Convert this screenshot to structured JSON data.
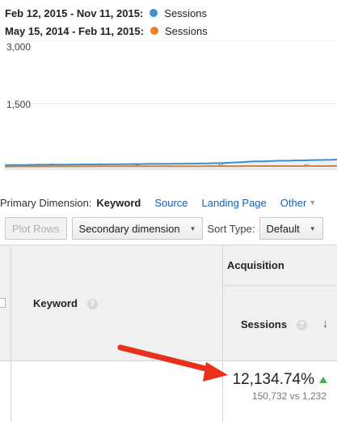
{
  "legend": [
    {
      "range": "Feb 12, 2015 - Nov 11, 2015:",
      "series": "Sessions",
      "color": "#3d8fcf"
    },
    {
      "range": "May 15, 2014 - Feb 11, 2015:",
      "series": "Sessions",
      "color": "#e8822d"
    }
  ],
  "chart": {
    "y_ticks": [
      "3,000",
      "1,500"
    ],
    "x_ticks": [
      "..",
      "..",
      "..",
      ".."
    ]
  },
  "chart_data": {
    "type": "line",
    "ylim": [
      0,
      3000
    ],
    "yticks": [
      3000,
      1500
    ],
    "series": [
      {
        "name": "Sessions",
        "color": "#3d8fcf",
        "values": [
          40,
          42,
          45,
          44,
          46,
          48,
          50,
          49,
          52,
          50,
          51,
          53,
          55,
          54,
          56,
          58,
          57,
          60,
          58,
          61,
          63,
          62,
          64,
          66,
          65,
          68,
          70,
          69,
          72,
          71,
          74,
          73,
          76,
          78,
          77,
          80,
          82,
          84,
          86,
          90,
          96,
          104,
          110,
          118,
          125,
          130,
          128,
          134,
          140,
          145,
          142,
          148,
          152,
          150,
          155,
          158,
          160,
          162,
          165,
          170
        ]
      },
      {
        "name": "Sessions",
        "color": "#e8822d",
        "values": [
          8,
          8,
          9,
          9,
          9,
          10,
          10,
          10,
          10,
          11,
          11,
          11,
          12,
          12,
          12,
          12,
          13,
          13,
          13,
          13,
          14,
          14,
          14,
          14,
          14,
          15,
          15,
          15,
          15,
          15,
          16,
          16,
          16,
          16,
          16,
          16,
          17,
          17,
          17,
          17,
          17,
          17,
          17,
          18,
          18,
          18,
          18,
          18,
          18,
          18,
          18,
          19,
          19,
          19,
          19,
          19,
          19,
          19,
          20,
          20
        ]
      }
    ]
  },
  "dimension_bar": {
    "label": "Primary Dimension:",
    "active": "Keyword",
    "links": [
      "Source",
      "Landing Page"
    ],
    "other": "Other"
  },
  "toolbar": {
    "plot_rows": "Plot Rows",
    "secondary_dimension": "Secondary dimension",
    "sort_type_label": "Sort Type:",
    "sort_type_value": "Default"
  },
  "table": {
    "keyword_header": "Keyword",
    "acquisition_header": "Acquisition",
    "sessions_header": "Sessions",
    "help_glyph": "?",
    "sort_glyph": "↓",
    "row": {
      "sessions_change": "12,134.74%",
      "sessions_compare": "150,732 vs 1,232"
    }
  },
  "colors": {
    "accent_blue": "#3d8fcf",
    "accent_orange": "#e8822d",
    "link": "#1a5fb4",
    "up_green": "#4caf50",
    "annotation_red": "#e8301c"
  }
}
